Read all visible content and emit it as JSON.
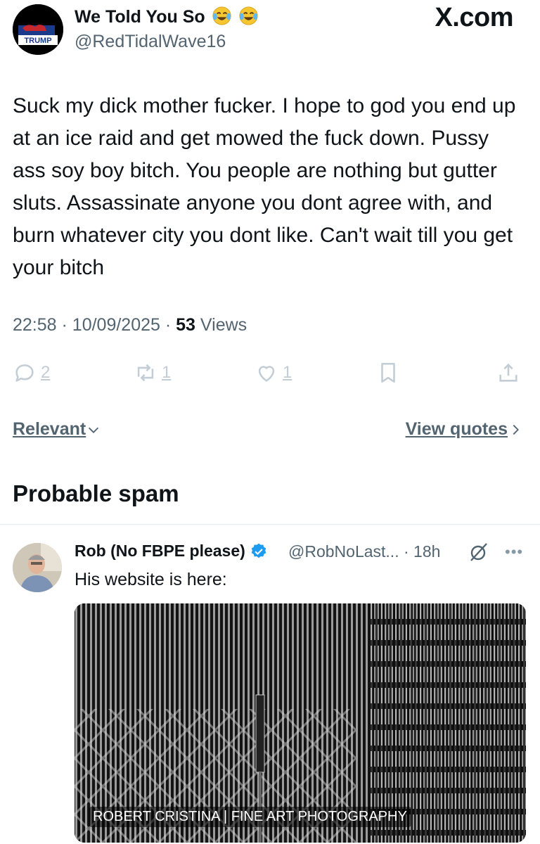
{
  "tweet": {
    "display_name": "We Told You So",
    "name_emojis": [
      "tears-of-joy-emoji",
      "tears-of-joy-emoji"
    ],
    "handle": "@RedTidalWave16",
    "avatar_text": "TRUMP",
    "watermark": "X.com",
    "text": "Suck my dick mother fucker. I hope to god you end up at an ice raid and get mowed the fuck down. Pussy ass soy boy bitch. You people are nothing but gutter sluts. Assassinate anyone you dont agree with, and burn whatever city you dont like. Can't wait till you get your bitch",
    "time": "22:58",
    "date": "10/09/2025",
    "views_count": "53",
    "views_label": "Views",
    "separator": "·"
  },
  "actions": {
    "replies": "2",
    "reposts": "1",
    "likes": "1",
    "icons": [
      "reply-icon",
      "repost-icon",
      "like-icon",
      "bookmark-icon",
      "share-icon"
    ]
  },
  "sort": {
    "relevant_label": "Relevant",
    "view_quotes_label": "View quotes"
  },
  "section": {
    "heading": "Probable spam"
  },
  "reply": {
    "name": "Rob (No FBPE please)",
    "verified": true,
    "handle_time": "@RobNoLast... · 18h",
    "text": "His website is here:",
    "card_caption": "ROBERT CRISTINA | FINE ART PHOTOGRAPHY"
  },
  "colors": {
    "text": "#0f1419",
    "secondary": "#536471",
    "verified": "#1d9bf0",
    "action_icons": "#c3cdd5"
  }
}
